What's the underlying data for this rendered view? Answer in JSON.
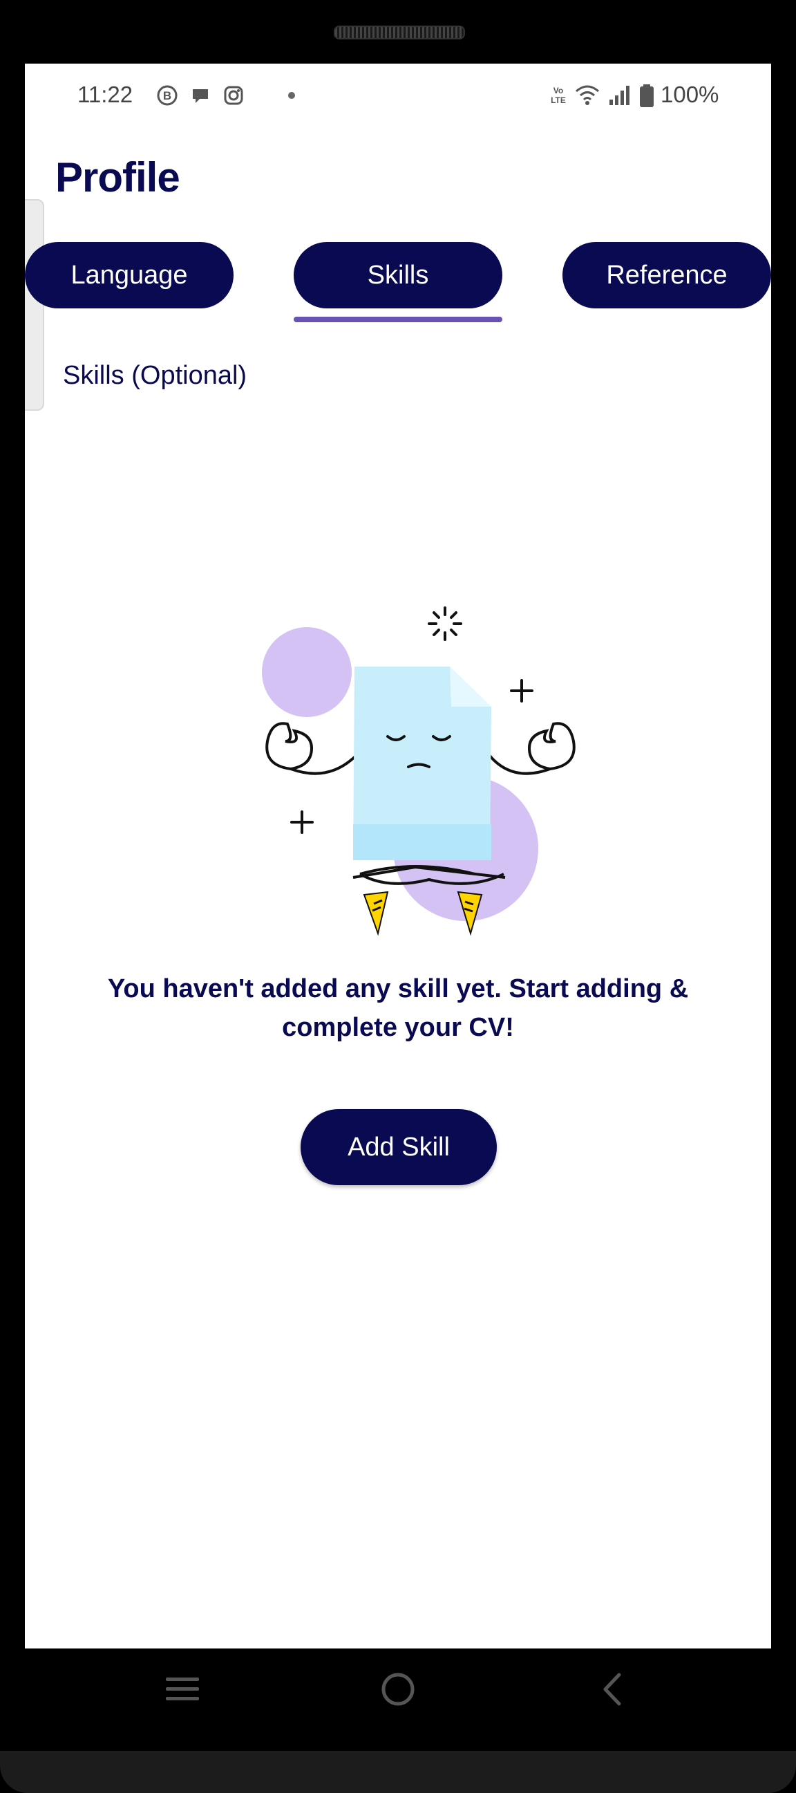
{
  "status_bar": {
    "time": "11:22",
    "battery": "100%",
    "left_icons": [
      "b-chat-icon",
      "message-bubble-icon",
      "instagram-icon",
      "dot-icon"
    ],
    "right_icons": [
      "volte-icon",
      "wifi-icon",
      "signal-icon",
      "battery-icon"
    ]
  },
  "header": {
    "title": "Profile"
  },
  "tabs": [
    {
      "label": "Language",
      "active": false
    },
    {
      "label": "Skills",
      "active": true
    },
    {
      "label": "Reference",
      "active": false
    }
  ],
  "section": {
    "title": "Skills (Optional)"
  },
  "empty_state": {
    "illustration": "meditating-document-illustration",
    "message": "You haven't added any skill yet. Start adding & complete your CV!",
    "button_label": "Add Skill"
  },
  "nav_bar": {
    "icons": [
      "menu-icon",
      "home-icon",
      "back-icon"
    ]
  },
  "colors": {
    "primary": "#0a0a52",
    "indicator": "#6a52b5",
    "blob": "#d4c2f5",
    "doc": "#c8eefc",
    "accent": "#ffd400"
  }
}
